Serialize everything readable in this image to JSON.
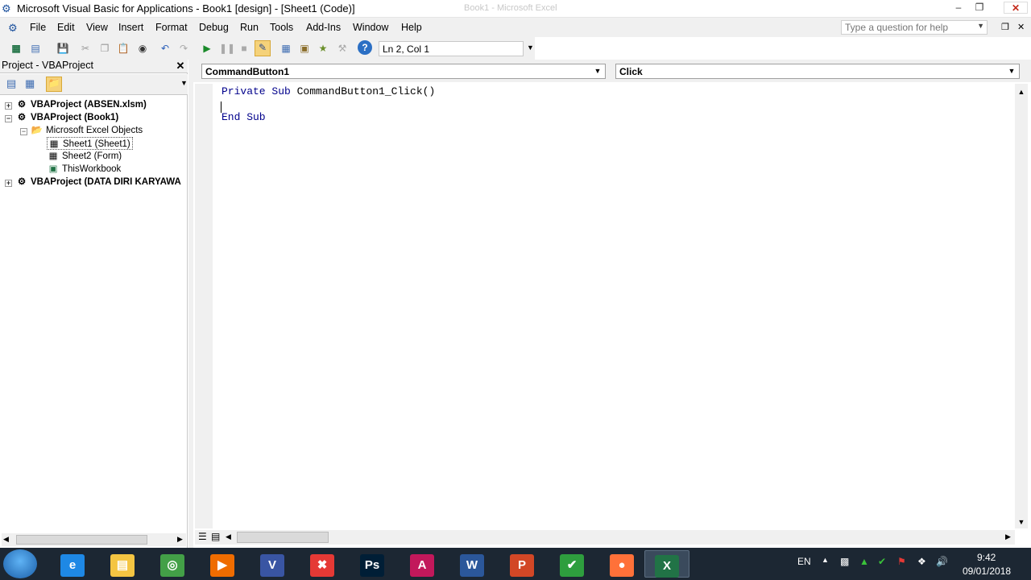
{
  "titlebar": {
    "title": "Microsoft Visual Basic for Applications - Book1 [design] - [Sheet1 (Code)]",
    "background_title": "Book1 - Microsoft Excel",
    "minimize": "–",
    "restore": "❐",
    "close": "✕"
  },
  "menubar": {
    "items": [
      "File",
      "Edit",
      "View",
      "Insert",
      "Format",
      "Debug",
      "Run",
      "Tools",
      "Add-Ins",
      "Window",
      "Help"
    ],
    "help_placeholder": "Type a question for help",
    "inner_minimize": "–",
    "inner_restore": "❐",
    "inner_close": "✕"
  },
  "toolbar": {
    "position": "Ln 2, Col 1"
  },
  "project": {
    "title": "Project - VBAProject",
    "close": "✕",
    "tree": [
      {
        "label": "VBAProject (ABSEN.xlsm)",
        "toggle": "+"
      },
      {
        "label": "VBAProject (Book1)",
        "toggle": "−"
      },
      {
        "label": "Microsoft Excel Objects",
        "toggle": "−"
      },
      {
        "label": "Sheet1 (Sheet1)"
      },
      {
        "label": "Sheet2 (Form)"
      },
      {
        "label": "ThisWorkbook"
      },
      {
        "label": "VBAProject (DATA DIRI KARYAWA",
        "toggle": "+"
      }
    ]
  },
  "code": {
    "object_combo": "CommandButton1",
    "procedure_combo": "Click",
    "lines": [
      {
        "kw": "Private Sub ",
        "rest": "CommandButton1_Click()"
      },
      {
        "kw": "",
        "rest": ""
      },
      {
        "kw": "End Sub",
        "rest": ""
      }
    ]
  },
  "taskbar": {
    "language": "EN",
    "time": "9:42",
    "date": "09/01/2018",
    "apps": [
      {
        "name": "Internet Explorer",
        "glyph": "e",
        "color": "#1e88e5"
      },
      {
        "name": "File Explorer",
        "glyph": "▤",
        "color": "#f4c542"
      },
      {
        "name": "Green App",
        "glyph": "◎",
        "color": "#43a047"
      },
      {
        "name": "Media Player",
        "glyph": "▶",
        "color": "#ef6c00"
      },
      {
        "name": "Visio",
        "glyph": "V",
        "color": "#3955a3"
      },
      {
        "name": "Red App",
        "glyph": "✖",
        "color": "#e53935"
      },
      {
        "name": "Photoshop",
        "glyph": "Ps",
        "color": "#001e36"
      },
      {
        "name": "Access",
        "glyph": "A",
        "color": "#c2185b"
      },
      {
        "name": "Word",
        "glyph": "W",
        "color": "#2b579a"
      },
      {
        "name": "PowerPoint",
        "glyph": "P",
        "color": "#d24726"
      },
      {
        "name": "Camtasia",
        "glyph": "✔",
        "color": "#2e9e3e"
      },
      {
        "name": "Firefox",
        "glyph": "●",
        "color": "#ff7139"
      },
      {
        "name": "Excel",
        "glyph": "X",
        "color": "#217346"
      }
    ]
  }
}
